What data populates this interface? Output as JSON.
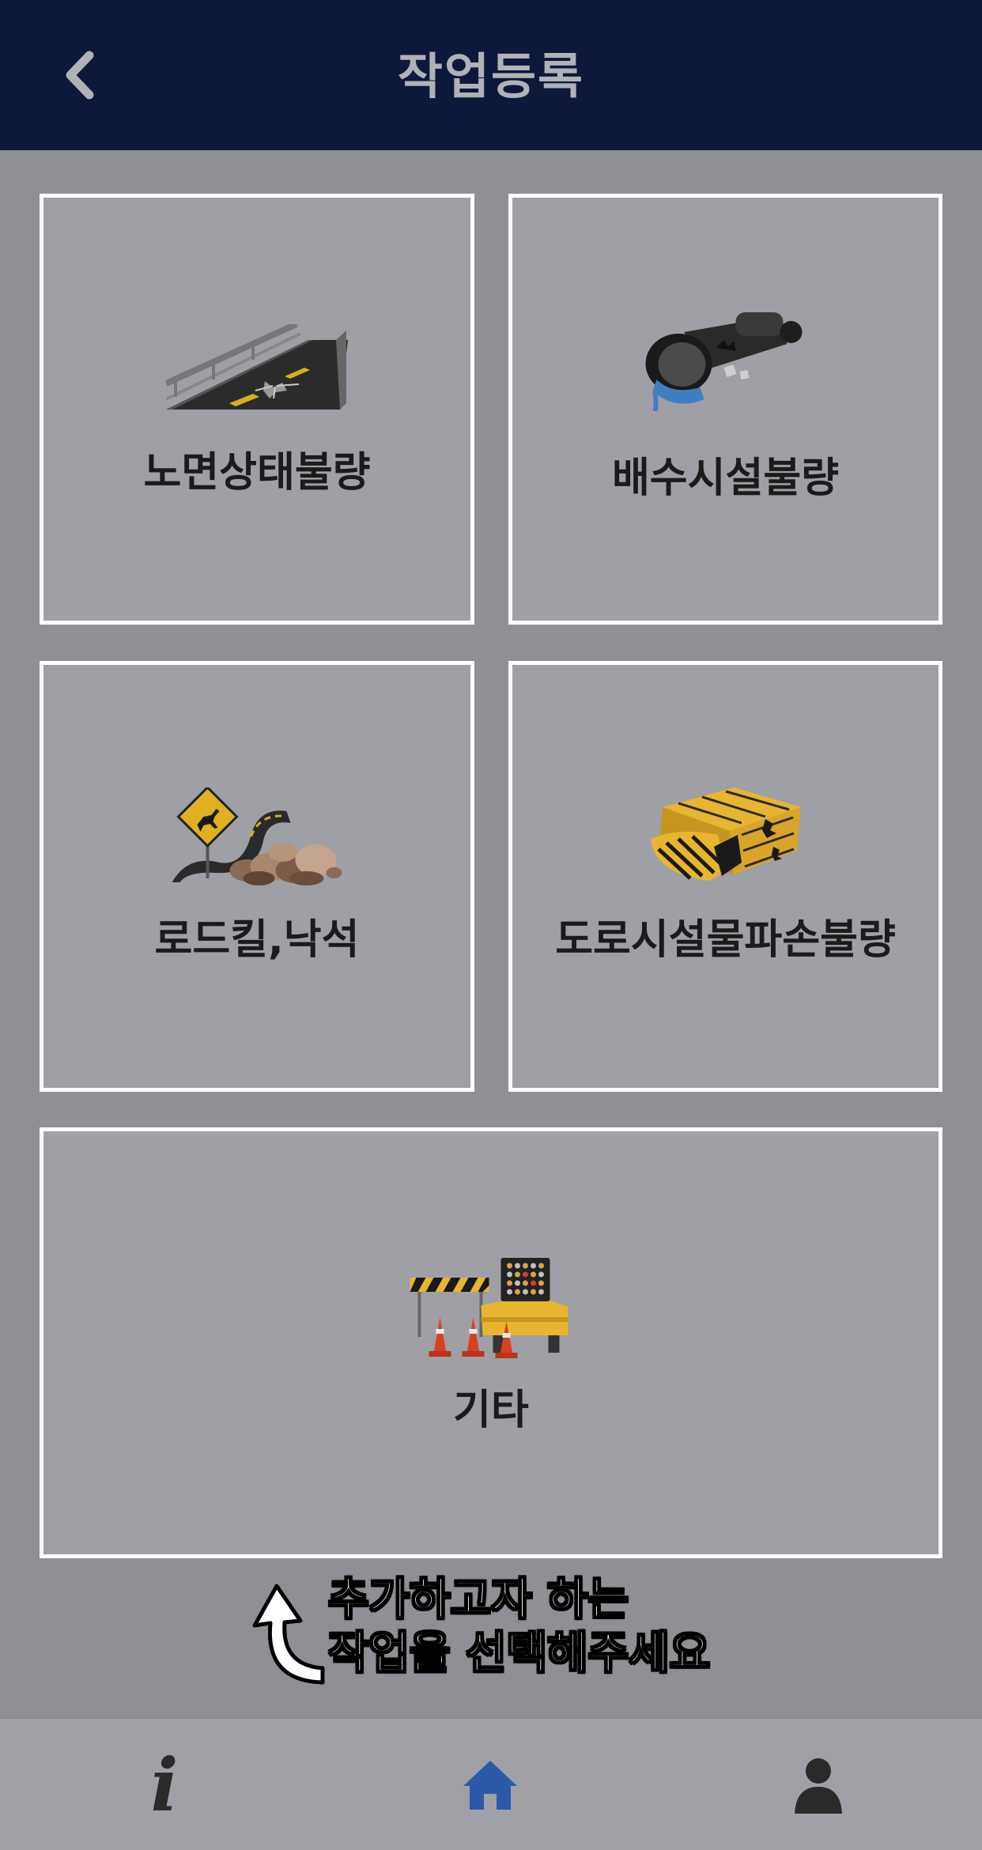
{
  "header": {
    "title": "작업등록",
    "back_icon": "chevron-left-icon"
  },
  "categories": [
    {
      "label": "노면상태불량",
      "icon": "road-surface-icon"
    },
    {
      "label": "배수시설불량",
      "icon": "drain-pipe-icon"
    },
    {
      "label": "로드킬,낙석",
      "icon": "roadkill-rockfall-icon"
    },
    {
      "label": "도로시설물파손불량",
      "icon": "road-facility-damage-icon"
    },
    {
      "label": "기타",
      "icon": "roadwork-misc-icon"
    }
  ],
  "hint": {
    "line1": "추가하고자 하는",
    "line2": "작업을 선택해주세요",
    "icon": "curved-arrow-up-icon"
  },
  "nav": {
    "items": [
      {
        "icon": "info-icon",
        "active": false
      },
      {
        "icon": "home-icon",
        "active": true
      },
      {
        "icon": "user-icon",
        "active": false
      }
    ],
    "active_color": "#2d5aa8"
  },
  "colors": {
    "header_bg": "#0d183b",
    "body_bg": "#8e9095",
    "tile_bg": "#9fa0a5",
    "tile_border": "#ffffff"
  }
}
